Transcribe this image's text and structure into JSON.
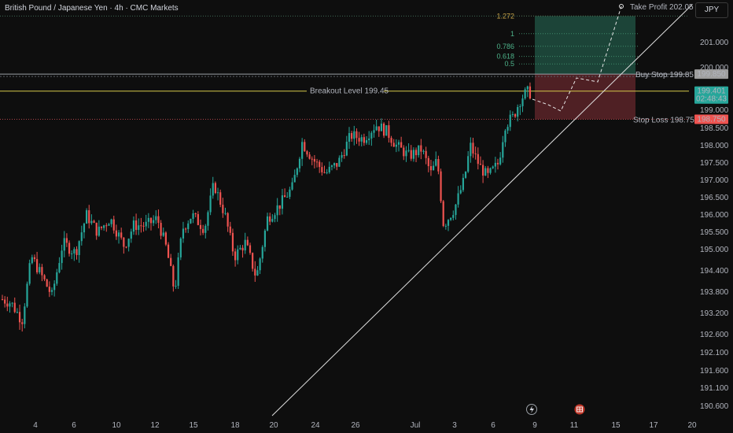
{
  "header": {
    "title": "British Pound / Japanese Yen · 4h · CMC Markets"
  },
  "currency_button": "JPY",
  "levels": {
    "take_profit": "Take Profit 202.05",
    "buy_stop": "Buy Stop 199.85",
    "breakout": "Breakout Level 199.45",
    "stop_loss": "Stop Loss 198.75"
  },
  "price_tags": {
    "buy_stop": "199.850",
    "current": "199.401",
    "countdown": "02:48:43",
    "stop_loss": "198.750"
  },
  "fib_labels": [
    "1.272",
    "1",
    "0.786",
    "0.618",
    "0.5"
  ],
  "colors": {
    "up": "#26a69a",
    "down": "#ef5350",
    "breakout": "#d4c84a",
    "take_profit_text": "#4caf50",
    "stop_loss_text": "#ef5350",
    "profit_zone": "#1f4d3f",
    "loss_zone": "#5a2328"
  },
  "icons": {
    "lightning": "lightning-icon",
    "calendar": "calendar-flag-icon"
  },
  "chart_data": {
    "type": "candlestick",
    "title": "British Pound / Japanese Yen · 4h · CMC Markets",
    "y_ticks": [
      "201.000",
      "200.000",
      "199.000",
      "198.500",
      "198.000",
      "197.500",
      "197.000",
      "196.500",
      "196.000",
      "195.500",
      "195.000",
      "194.400",
      "193.800",
      "193.200",
      "192.600",
      "192.100",
      "191.600",
      "191.100",
      "190.600"
    ],
    "x_ticks": [
      "4",
      "6",
      "10",
      "12",
      "15",
      "18",
      "20",
      "24",
      "26",
      "Jul",
      "3",
      "6",
      "9",
      "11",
      "15",
      "17",
      "20"
    ],
    "ylim": [
      190.4,
      202.3
    ],
    "price_levels": {
      "take_profit": 202.05,
      "buy_stop": 199.85,
      "breakout": 199.45,
      "stop_loss": 198.75
    },
    "fib_levels": [
      {
        "label": "1.272",
        "price": 202.05
      },
      {
        "label": "1",
        "price": 201.35
      },
      {
        "label": "0.786",
        "price": 200.85
      },
      {
        "label": "0.618",
        "price": 200.45
      },
      {
        "label": "0.5",
        "price": 200.15
      }
    ],
    "trendline": {
      "from": {
        "date": "20",
        "price": 190.45
      },
      "to": "toward top-right beyond 202.05"
    },
    "projected_path": [
      199.401,
      199.05,
      199.9,
      199.85,
      202.05
    ]
  }
}
